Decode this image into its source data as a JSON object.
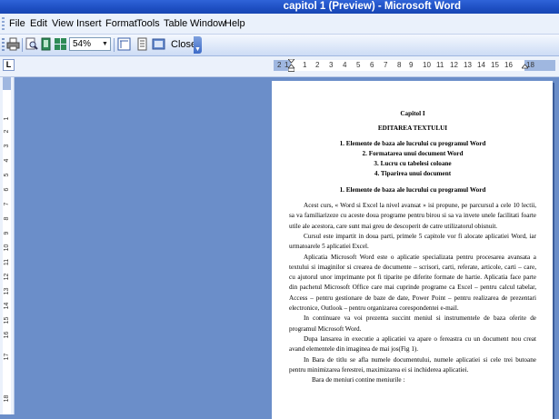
{
  "window": {
    "title": "capitol 1 (Preview) - Microsoft Word"
  },
  "menu": {
    "items": [
      "File",
      "Edit",
      "View",
      "Insert",
      "Format",
      "Tools",
      "Table",
      "Window",
      "Help"
    ]
  },
  "toolbar": {
    "zoom": "54%",
    "close_label": "Close"
  },
  "ruler": {
    "h_numbers": [
      "2",
      "1",
      "1",
      "2",
      "3",
      "4",
      "5",
      "6",
      "7",
      "8",
      "9",
      "10",
      "11",
      "12",
      "13",
      "14",
      "15",
      "16",
      "18"
    ],
    "v_numbers": [
      "1",
      "2",
      "3",
      "4",
      "5",
      "6",
      "7",
      "8",
      "9",
      "10",
      "11",
      "12",
      "13",
      "14",
      "15",
      "16",
      "17",
      "18"
    ]
  },
  "document": {
    "chapter": "Capitol I",
    "heading": "EDITAREA TEXTULUI",
    "toc": [
      "1.   Elemente de baza ale lucrului cu programul Word",
      "2.   Formatarea unui document Word",
      "3.   Lucru cu tabelesi coloane",
      "4.   Tiparirea unui document"
    ],
    "section": "1.   Elemente de baza ale lucrului cu programul Word",
    "p1": "Acest curs, « Word si Excel la nivel avansat » isi propune, pe parcursul a cele 10 lectii, sa va familiarizeze cu aceste doua programe pentru birou si sa va invete unele facilitati foarte utile ale acestora, care sunt mai greu de descoperit de catre utilizatorul obisnuit.",
    "p2": "Cursul este impartit in doua parti, primele 5 capitole vor fi alocate aplicatiei Word, iar urmatoarele 5 aplicatiei Excel.",
    "p3": "Aplicatia Microsoft Word este o aplicatie specializata pentru procesarea avansata a textului si imaginilor si crearea de documente – scrisori, carti, referate, articole, carti – care, cu ajutorul unor imprimante pot fi tiparite pe diferite formate de hartie. Aplicatia face parte din pachetul Microsoft Office care mai cuprinde programe ca Excel – pentru calcul tabelar, Access – pentru gestionare de baze de date, Power Point – pentru realizarea de prezentari electronice, Outlook – pentru organizarea corespondentei e-mail.",
    "p4": "In continuare va voi prezenta succint meniul si instrumentele de baza oferite de programul Microsoft Word.",
    "p5": "Dupa lansarea in executie a aplicatiei va apare o fereastra cu un document nou creat avand elementele din imaginea de mai jos(Fig 1).",
    "p6": "In Bara de titlu se afla numele documentului, numele aplicatiei si cele trei butoane pentru minimizarea ferestrei, maximizarea ei si inchiderea aplicatiei.",
    "p7": "Bara de meniuri contine meniurile :"
  }
}
